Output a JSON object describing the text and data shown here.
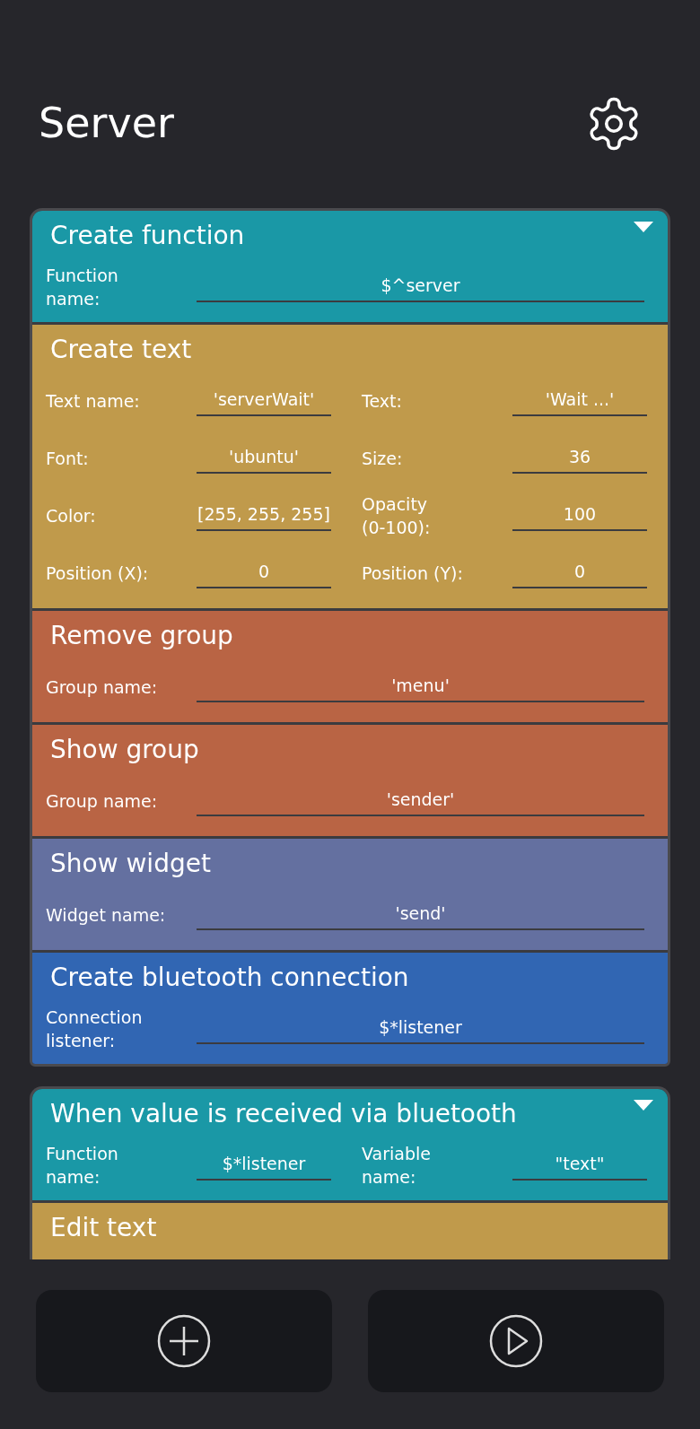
{
  "title": "Server",
  "scripts": [
    {
      "blocks": [
        {
          "kind": "event",
          "title": "Create function",
          "color": "#1a98a6",
          "fields": [
            {
              "label": "Function name:",
              "value": "$^server"
            }
          ]
        },
        {
          "kind": "action",
          "title": "Create text",
          "color": "#c09a4b",
          "fields": [
            {
              "label": "Text name:",
              "value": "'serverWait'"
            },
            {
              "label": "Text:",
              "value": "'Wait ...'"
            },
            {
              "label": "Font:",
              "value": "'ubuntu'"
            },
            {
              "label": "Size:",
              "value": "36"
            },
            {
              "label": "Color:",
              "value": "[255, 255, 255]"
            },
            {
              "label": "Opacity (0-100):",
              "value": "100"
            },
            {
              "label": "Position (X):",
              "value": "0"
            },
            {
              "label": "Position (Y):",
              "value": "0"
            }
          ]
        },
        {
          "kind": "action",
          "title": "Remove group",
          "color": "#b96444",
          "fields": [
            {
              "label": "Group name:",
              "value": "'menu'"
            }
          ]
        },
        {
          "kind": "action",
          "title": "Show group",
          "color": "#b96444",
          "fields": [
            {
              "label": "Group name:",
              "value": "'sender'"
            }
          ]
        },
        {
          "kind": "action",
          "title": "Show widget",
          "color": "#6470a0",
          "fields": [
            {
              "label": "Widget name:",
              "value": "'send'"
            }
          ]
        },
        {
          "kind": "action",
          "title": "Create bluetooth connection",
          "color": "#3166b3",
          "fields": [
            {
              "label": "Connection listener:",
              "value": "$*listener"
            }
          ]
        }
      ]
    },
    {
      "blocks": [
        {
          "kind": "event",
          "title": "When value is received via bluetooth",
          "color": "#1a98a6",
          "fields": [
            {
              "label": "Function name:",
              "value": "$*listener"
            },
            {
              "label": "Variable name:",
              "value": "\"text\""
            }
          ]
        },
        {
          "kind": "action",
          "title": "Edit text",
          "color": "#c09a4b"
        }
      ]
    }
  ]
}
